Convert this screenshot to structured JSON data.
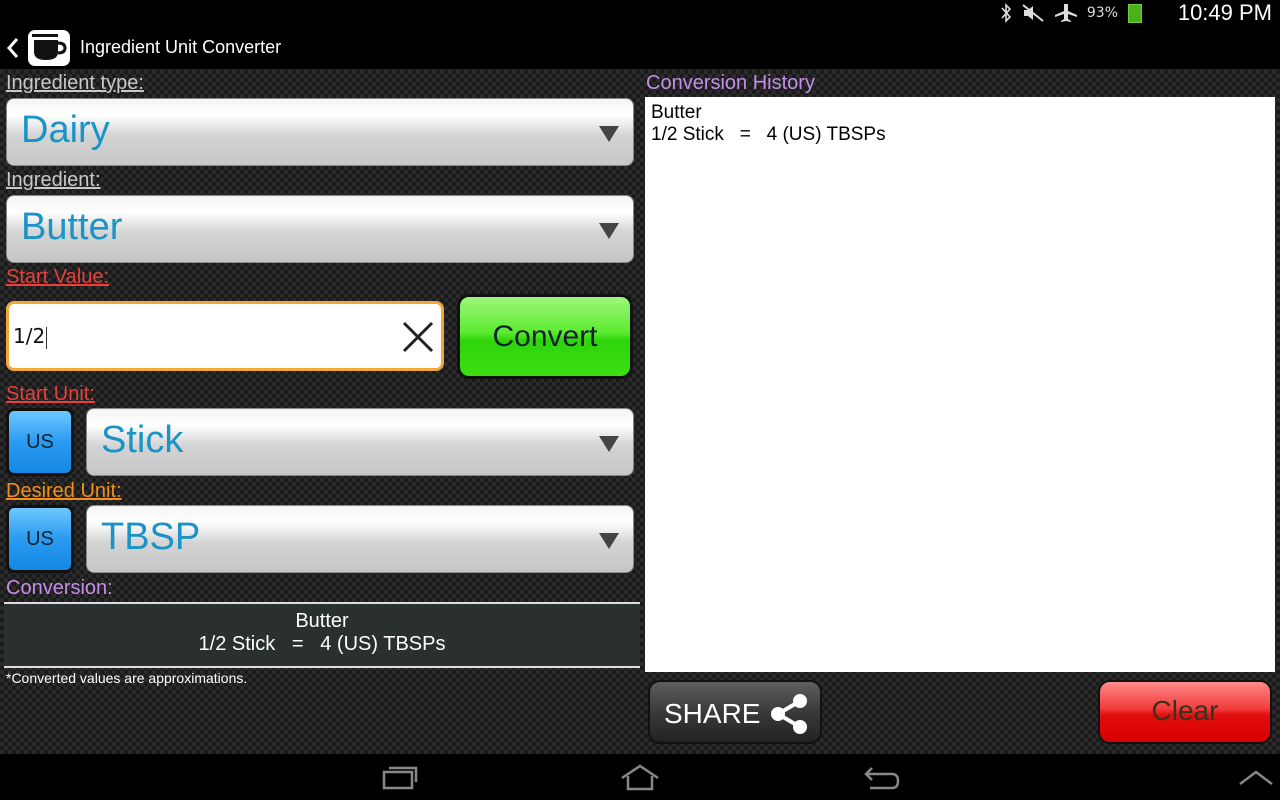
{
  "status": {
    "battery": "93%",
    "time": "10:49 PM"
  },
  "app": {
    "title": "Ingredient Unit Converter"
  },
  "form": {
    "ingredient_type_label": "Ingredient type:",
    "ingredient_type_value": "Dairy",
    "ingredient_label": "Ingredient:",
    "ingredient_value": "Butter",
    "start_value_label": "Start Value:",
    "start_value": "1/2",
    "convert_label": "Convert",
    "start_unit_label": "Start Unit:",
    "start_unit_system": "US",
    "start_unit_value": "Stick",
    "desired_unit_label": "Desired Unit:",
    "desired_unit_system": "US",
    "desired_unit_value": "TBSP",
    "conversion_label": "Conversion:",
    "result_line1": "Butter",
    "result_line2": "1/2 Stick   =   4 (US) TBSPs",
    "note": "*Converted values are approximations."
  },
  "history": {
    "title": "Conversion History",
    "entries": [
      {
        "line1": "Butter",
        "line2": "1/2 Stick   =   4 (US) TBSPs"
      }
    ]
  },
  "buttons": {
    "share": "SHARE",
    "clear": "Clear"
  },
  "colors": {
    "accent_blue": "#1a94c6",
    "convert_green": "#2ed40a",
    "clear_red": "#e20e0e",
    "start_label_red": "#e8403a",
    "desired_label_orange": "#f0901a"
  }
}
